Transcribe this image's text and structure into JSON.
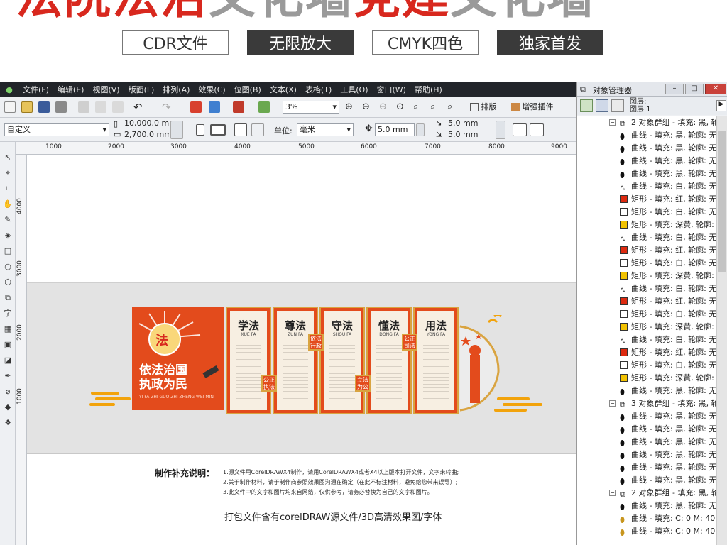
{
  "banner": {
    "title_red_1": "法院法治",
    "title_gray_1": "文化墙",
    "title_red_2": "党建",
    "title_gray_2": "文化墙",
    "tags": [
      "CDR文件",
      "无限放大",
      "CMYK四色",
      "独家首发"
    ]
  },
  "menubar": {
    "items": [
      "文件(F)",
      "编辑(E)",
      "视图(V)",
      "版面(L)",
      "排列(A)",
      "效果(C)",
      "位图(B)",
      "文本(X)",
      "表格(T)",
      "工具(O)",
      "窗口(W)",
      "帮助(H)"
    ]
  },
  "toolbar1": {
    "zoom": "3%",
    "layout_label": "排版",
    "plugin_label": "增强插件"
  },
  "toolbar2": {
    "preset": "自定义",
    "width": "10,000.0 mm",
    "height": "2,700.0 mm",
    "unit_label": "单位:",
    "unit_value": "毫米",
    "nudge": "5.0 mm",
    "dup_x": "5.0 mm",
    "dup_y": "5.0 mm"
  },
  "ruler": {
    "h_ticks": [
      "1000",
      "2000",
      "3000",
      "4000",
      "5000",
      "6000",
      "7000",
      "8000",
      "9000"
    ],
    "v_ticks": [
      "4000",
      "3000",
      "2000",
      "1000"
    ]
  },
  "design": {
    "motto_1": "依法治国",
    "motto_2": "执政为民",
    "motto_pinyin": "YI FA ZHI GUO ZHI ZHENG WEI MIN",
    "panels": [
      {
        "title": "学法",
        "pinyin": "XUE FA"
      },
      {
        "title": "尊法",
        "pinyin": "ZUN FA"
      },
      {
        "title": "守法",
        "pinyin": "SHOU FA"
      },
      {
        "title": "懂法",
        "pinyin": "DONG FA"
      },
      {
        "title": "用法",
        "pinyin": "YONG FA"
      }
    ],
    "seals": [
      "依法行政",
      "公正执法",
      "立法为公",
      "公正司法"
    ]
  },
  "notes": {
    "title": "制作补充说明：",
    "lines": [
      "1.源文件用CorelDRAWX4制作，请用CorelDRAWX4或者X4以上版本打开文件，文字未转曲;",
      "2.关于制作材料，请于制作商参照效果图沟通在确定（在此不标注材料，避免给您带来误导）;",
      "3.此文件中的文字和图片均来自网络，仅供参考，请务必替换为自己的文字和图片。"
    ],
    "pack": "打包文件含有corelDRAW源文件/3D高清效果图/字体"
  },
  "object_manager": {
    "title": "对象管理器",
    "layer_label_1": "图层:",
    "layer_label_2": "图层 1",
    "colors": {
      "black": "#111111",
      "white": "#ffffff",
      "red": "#dd2a10",
      "yellow": "#f2c200",
      "gold": "#c8961e"
    },
    "rows": [
      {
        "kind": "group",
        "text": "2 对象群组 - 填充: 黑, 轮"
      },
      {
        "kind": "curve",
        "swatch": "black",
        "text": "曲线 - 填充: 黑, 轮廓: 无"
      },
      {
        "kind": "curve",
        "swatch": "black",
        "text": "曲线 - 填充: 黑, 轮廓: 无"
      },
      {
        "kind": "curve",
        "swatch": "black",
        "text": "曲线 - 填充: 黑, 轮廓: 无"
      },
      {
        "kind": "curve",
        "swatch": "black",
        "text": "曲线 - 填充: 黑, 轮廓: 无"
      },
      {
        "kind": "curve",
        "swatch": "white",
        "text": "曲线 - 填充: 白, 轮廓: 无"
      },
      {
        "kind": "rect",
        "swatch": "red",
        "text": "矩形 - 填充: 红, 轮廓: 无"
      },
      {
        "kind": "rect",
        "swatch": "white",
        "text": "矩形 - 填充: 白, 轮廓: 无"
      },
      {
        "kind": "rect",
        "swatch": "yellow",
        "text": "矩形 - 填充: 深黄, 轮廓:"
      },
      {
        "kind": "curve",
        "swatch": "white",
        "text": "曲线 - 填充: 白, 轮廓: 无"
      },
      {
        "kind": "rect",
        "swatch": "red",
        "text": "矩形 - 填充: 红, 轮廓: 无"
      },
      {
        "kind": "rect",
        "swatch": "white",
        "text": "矩形 - 填充: 白, 轮廓: 无"
      },
      {
        "kind": "rect",
        "swatch": "yellow",
        "text": "矩形 - 填充: 深黄, 轮廓:"
      },
      {
        "kind": "curve",
        "swatch": "white",
        "text": "曲线 - 填充: 白, 轮廓: 无"
      },
      {
        "kind": "rect",
        "swatch": "red",
        "text": "矩形 - 填充: 红, 轮廓: 无"
      },
      {
        "kind": "rect",
        "swatch": "white",
        "text": "矩形 - 填充: 白, 轮廓: 无"
      },
      {
        "kind": "rect",
        "swatch": "yellow",
        "text": "矩形 - 填充: 深黄, 轮廓:"
      },
      {
        "kind": "curve",
        "swatch": "white",
        "text": "曲线 - 填充: 白, 轮廓: 无"
      },
      {
        "kind": "rect",
        "swatch": "red",
        "text": "矩形 - 填充: 红, 轮廓: 无"
      },
      {
        "kind": "rect",
        "swatch": "white",
        "text": "矩形 - 填充: 白, 轮廓: 无"
      },
      {
        "kind": "rect",
        "swatch": "yellow",
        "text": "矩形 - 填充: 深黄, 轮廓:"
      },
      {
        "kind": "curve",
        "swatch": "black",
        "text": "曲线 - 填充: 黑, 轮廓: 无"
      },
      {
        "kind": "group",
        "text": "3 对象群组 - 填充: 黑, 轮"
      },
      {
        "kind": "curve",
        "swatch": "black",
        "text": "曲线 - 填充: 黑, 轮廓: 无"
      },
      {
        "kind": "curve",
        "swatch": "black",
        "text": "曲线 - 填充: 黑, 轮廓: 无"
      },
      {
        "kind": "curve",
        "swatch": "black",
        "text": "曲线 - 填充: 黑, 轮廓: 无"
      },
      {
        "kind": "curve",
        "swatch": "black",
        "text": "曲线 - 填充: 黑, 轮廓: 无"
      },
      {
        "kind": "curve",
        "swatch": "black",
        "text": "曲线 - 填充: 黑, 轮廓: 无"
      },
      {
        "kind": "curve",
        "swatch": "black",
        "text": "曲线 - 填充: 黑, 轮廓: 无"
      },
      {
        "kind": "group",
        "text": "2 对象群组 - 填充: 黑, 轮"
      },
      {
        "kind": "curve",
        "swatch": "black",
        "text": "曲线 - 填充: 黑, 轮廓: 无"
      },
      {
        "kind": "curve",
        "swatch": "gold",
        "text": "曲线 - 填充: C: 0 M: 40"
      },
      {
        "kind": "curve",
        "swatch": "gold",
        "text": "曲线 - 填充: C: 0 M: 40"
      }
    ]
  }
}
